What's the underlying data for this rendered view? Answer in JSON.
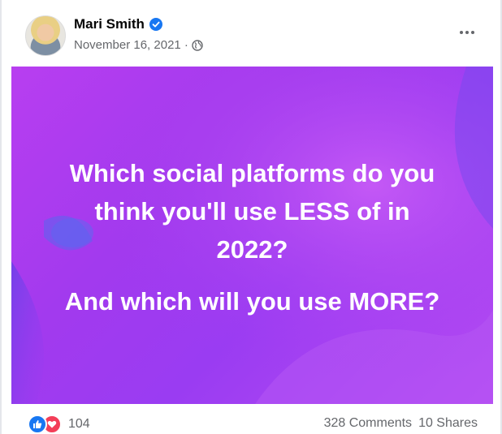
{
  "post": {
    "author": "Mari Smith",
    "date": "November 16, 2021 ·",
    "verified_icon": "verified-badge-icon",
    "privacy_icon": "globe-icon",
    "more_icon": "more-options-icon"
  },
  "image": {
    "question_lines": [
      "Which social platforms do you",
      "think you'll use LESS of in",
      "2022?"
    ],
    "followup": "And which will you use MORE?",
    "colors": {
      "primary": "#a23aee",
      "accent": "#c45af5",
      "shade": "#7b3fe8"
    }
  },
  "footer": {
    "reaction_count": "104",
    "comments": "328 Comments",
    "shares": "10 Shares",
    "reaction_icons": [
      "like-icon",
      "love-icon"
    ]
  },
  "colors": {
    "brand_blue": "#1877f2",
    "love_red": "#f33e58",
    "secondary_text": "#65676b"
  }
}
